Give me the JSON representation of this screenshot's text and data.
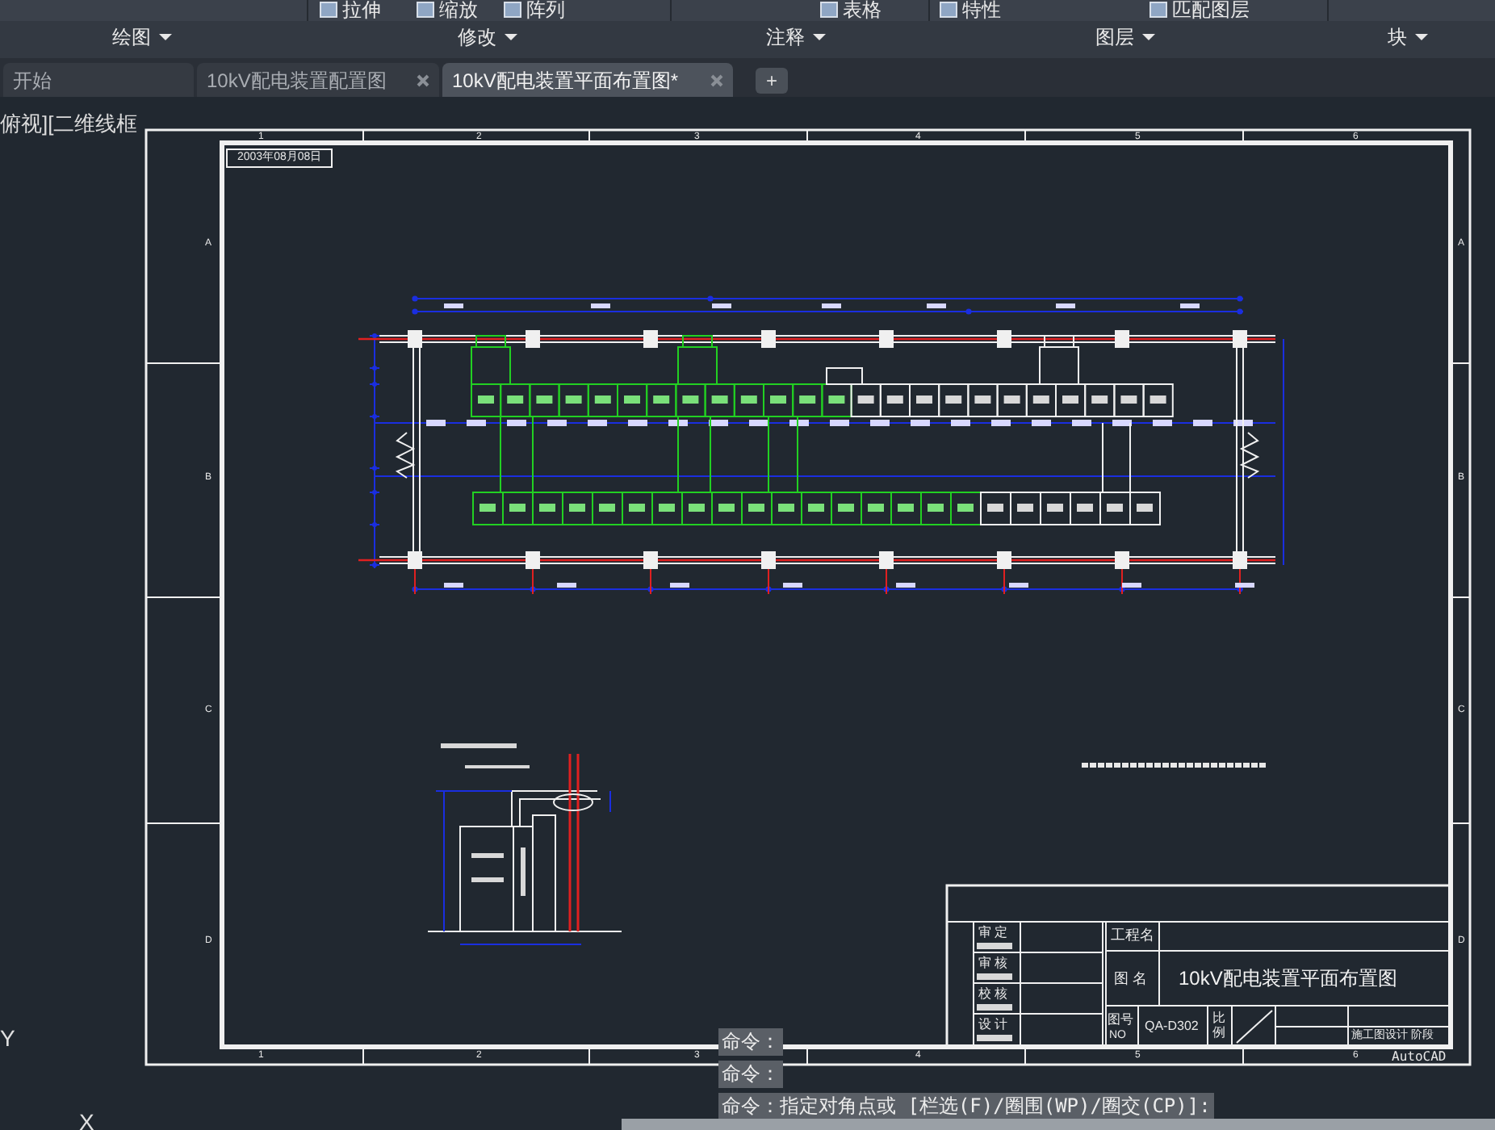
{
  "ribbon": {
    "tools": [
      {
        "label": "拉伸"
      },
      {
        "label": "缩放"
      },
      {
        "label": "阵列"
      },
      {
        "label": "表格"
      },
      {
        "label": "特性"
      },
      {
        "label": "匹配图层"
      }
    ],
    "panels": [
      {
        "label": "绘图"
      },
      {
        "label": "修改"
      },
      {
        "label": "注释"
      },
      {
        "label": "图层"
      },
      {
        "label": "块"
      }
    ]
  },
  "tabs": [
    {
      "label": "开始",
      "selected": false,
      "closable": false
    },
    {
      "label": "10kV配电装置配置图",
      "selected": false,
      "closable": true
    },
    {
      "label": "10kV配电装置平面布置图*",
      "selected": true,
      "closable": true
    }
  ],
  "viewport_label": "俯视][二维线框",
  "new_tab_button": "+",
  "sheet": {
    "date": "2003年08月08日",
    "top_numbers": [
      "1",
      "2",
      "3",
      "4",
      "5",
      "6"
    ],
    "bottom_numbers": [
      "1",
      "2",
      "3",
      "4",
      "5",
      "6"
    ],
    "left_letters": [
      "A",
      "B",
      "C",
      "D"
    ],
    "right_letters": [
      "A",
      "B",
      "C",
      "D"
    ]
  },
  "title_block": {
    "signatures": [
      "审 定",
      "审 核",
      "校 核",
      "设 计"
    ],
    "project_label": "工程名",
    "drawing_name_label": "图 名",
    "drawing_name": "10kV配电装置平面布置图",
    "number_label": "图号",
    "number_label_en": "NO",
    "number": "QA-D302",
    "scale_label": "比例",
    "stage": "施工图设计 阶段",
    "software": "AutoCAD"
  },
  "command_lines": [
    "命令：",
    "命令：",
    "命令：指定对角点或 [栏选(F)/圈围(WP)/圈交(CP)]:"
  ],
  "ucs": {
    "y_label": "Y",
    "x_label": "X"
  }
}
